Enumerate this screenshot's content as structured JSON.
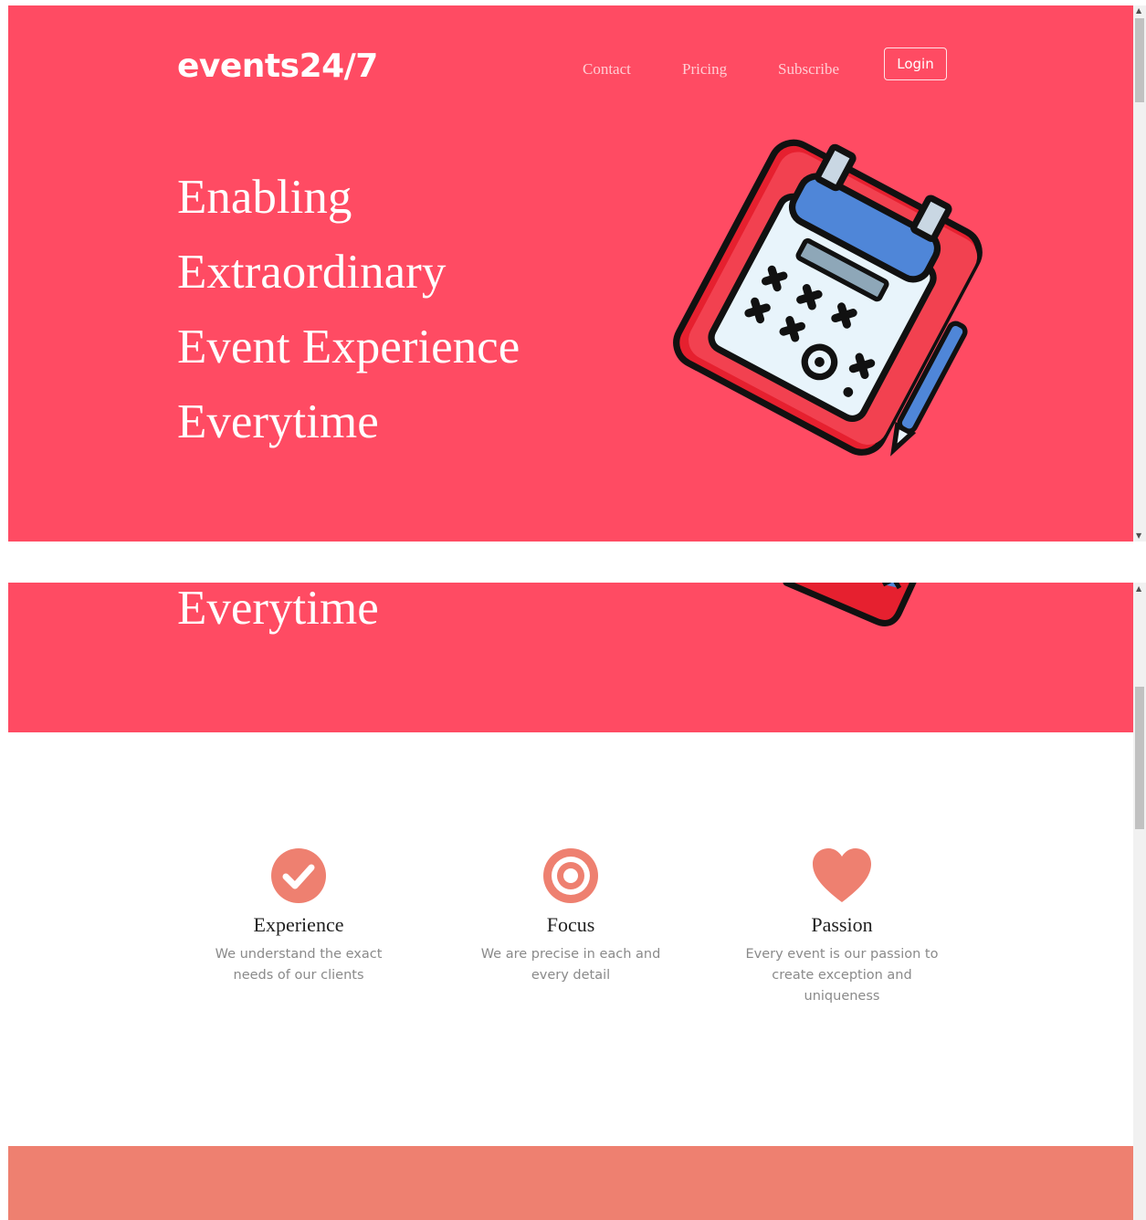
{
  "colors": {
    "hero_bg": "#ff4b63",
    "accent_icon": "#ee8070",
    "footer_band": "#ee8070",
    "feature_text": "#8a8a8a"
  },
  "header": {
    "logo": "events24/7",
    "nav": [
      {
        "label": "Contact"
      },
      {
        "label": "Pricing"
      },
      {
        "label": "Subscribe"
      }
    ],
    "login_label": "Login"
  },
  "hero": {
    "lines": [
      "Enabling",
      "Extraordinary",
      "Event Experience",
      "Everytime"
    ],
    "illustration": "clipboard-strategy-icon"
  },
  "features": [
    {
      "icon": "check-circle-icon",
      "title": "Experience",
      "text": "We understand the exact needs of our clients"
    },
    {
      "icon": "target-icon",
      "title": "Focus",
      "text": "We are precise in each and every detail"
    },
    {
      "icon": "heart-icon",
      "title": "Passion",
      "text": "Every event is our passion to create exception and uniqueness"
    }
  ]
}
